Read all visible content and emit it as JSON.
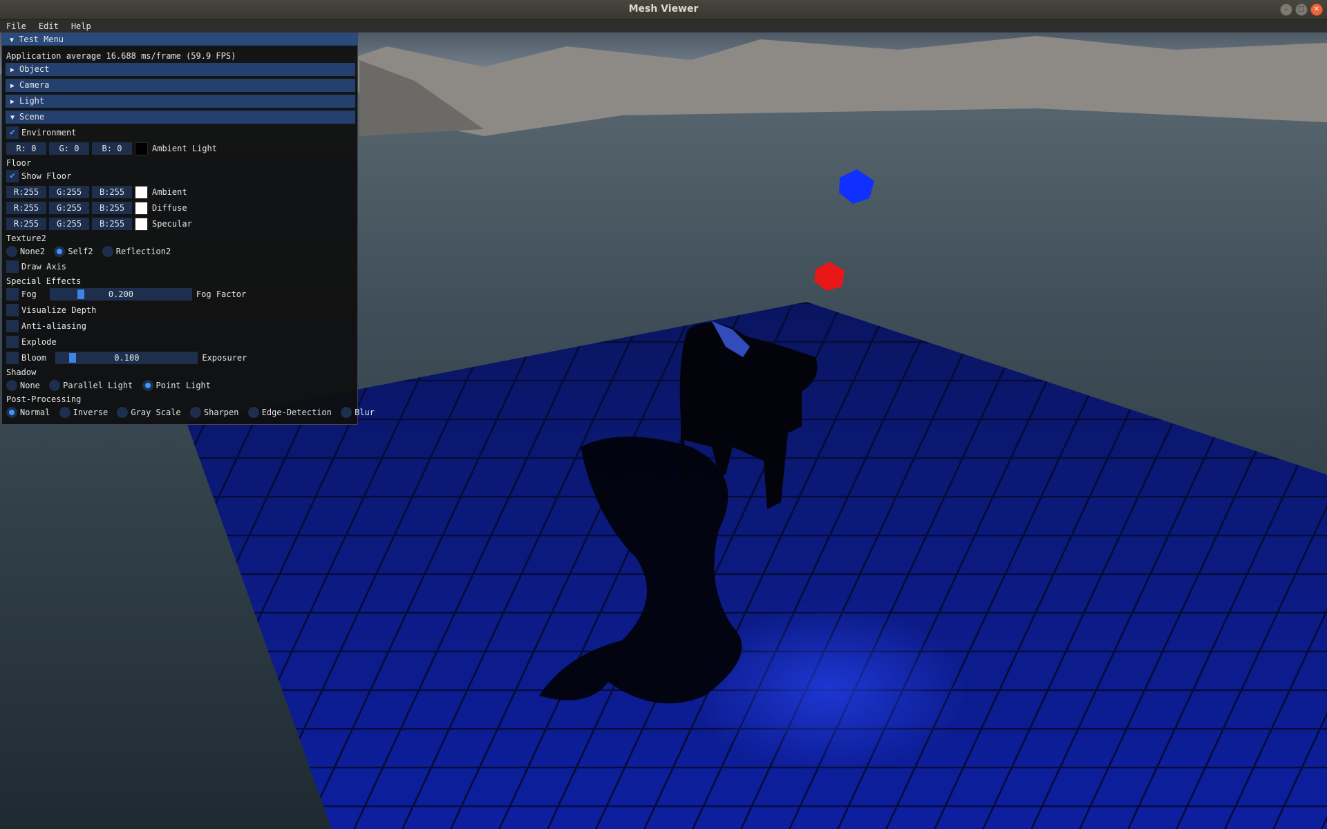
{
  "window": {
    "title": "Mesh Viewer",
    "buttons": [
      "–",
      "□",
      "✕"
    ]
  },
  "menubar": {
    "items": [
      "File",
      "Edit",
      "Help"
    ]
  },
  "panel": {
    "title": "Test Menu",
    "fps_text": "Application average 16.688 ms/frame (59.9 FPS)",
    "headers": {
      "object": "Object",
      "camera": "Camera",
      "light": "Light",
      "scene": "Scene"
    },
    "environment": {
      "label": "Environment",
      "checked": true,
      "r": "R:  0",
      "g": "G:  0",
      "b": "B:  0",
      "color_label": "Ambient Light",
      "color": "#000000"
    },
    "floor": {
      "section": "Floor",
      "show_label": "Show Floor",
      "show_checked": true,
      "ambient": {
        "r": "R:255",
        "g": "G:255",
        "b": "B:255",
        "label": "Ambient",
        "color": "#ffffff"
      },
      "diffuse": {
        "r": "R:255",
        "g": "G:255",
        "b": "B:255",
        "label": "Diffuse",
        "color": "#ffffff"
      },
      "specular": {
        "r": "R:255",
        "g": "G:255",
        "b": "B:255",
        "label": "Specular",
        "color": "#ffffff"
      }
    },
    "texture": {
      "section": "Texture2",
      "options": [
        "None2",
        "Self2",
        "Reflection2"
      ],
      "selected": "Self2"
    },
    "draw_axis": {
      "label": "Draw Axis",
      "checked": false
    },
    "effects": {
      "section": "Special Effects",
      "fog": {
        "label": "Fog",
        "value": "0.200",
        "fraction": 0.2,
        "slider_label": "Fog Factor",
        "checked": false
      },
      "visualize_depth": {
        "label": "Visualize Depth",
        "checked": false
      },
      "anti_aliasing": {
        "label": "Anti-aliasing",
        "checked": false
      },
      "explode": {
        "label": "Explode",
        "checked": false
      },
      "bloom": {
        "label": "Bloom",
        "value": "0.100",
        "fraction": 0.1,
        "slider_label": "Exposurer",
        "checked": false
      }
    },
    "shadow": {
      "section": "Shadow",
      "options": [
        "None",
        "Parallel Light",
        "Point Light"
      ],
      "selected": "Point Light"
    },
    "post": {
      "section": "Post-Processing",
      "options": [
        "Normal",
        "Inverse",
        "Gray Scale",
        "Sharpen",
        "Edge-Detection",
        "Blur"
      ],
      "selected": "Normal"
    }
  },
  "colors": {
    "accent": "#4296fa",
    "header": "#24406e",
    "frame": "#1d2f4c",
    "floor": "#0a1a8a"
  }
}
